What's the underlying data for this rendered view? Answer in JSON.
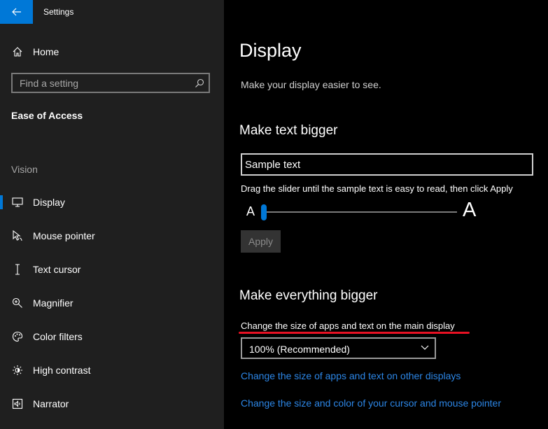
{
  "window": {
    "title": "Settings"
  },
  "sidebar": {
    "home_label": "Home",
    "search": {
      "placeholder": "Find a setting"
    },
    "section_title": "Ease of Access",
    "group_header": "Vision",
    "items": [
      {
        "label": "Display",
        "icon": "monitor-icon",
        "selected": true
      },
      {
        "label": "Mouse pointer",
        "icon": "mouse-pointer-icon"
      },
      {
        "label": "Text cursor",
        "icon": "text-cursor-icon"
      },
      {
        "label": "Magnifier",
        "icon": "magnifier-icon"
      },
      {
        "label": "Color filters",
        "icon": "palette-icon"
      },
      {
        "label": "High contrast",
        "icon": "high-contrast-icon"
      },
      {
        "label": "Narrator",
        "icon": "narrator-icon"
      }
    ]
  },
  "main": {
    "title": "Display",
    "subtitle": "Make your display easier to see.",
    "text_bigger": {
      "heading": "Make text bigger",
      "sample_text": "Sample text",
      "hint": "Drag the slider until the sample text is easy to read, then click Apply",
      "slider_min_label": "A",
      "slider_max_label": "A",
      "slider_value": 0,
      "apply_label": "Apply"
    },
    "everything_bigger": {
      "heading": "Make everything bigger",
      "change_label": "Change the size of apps and text on the main display",
      "dropdown_value": "100% (Recommended)",
      "link_other_displays": "Change the size of apps and text on other displays",
      "link_cursor": "Change the size and color of your cursor and mouse pointer"
    }
  },
  "colors": {
    "accent": "#0078d7",
    "link": "#2c86e6",
    "highlight_underline": "#e81123",
    "sidebar_bg": "#1f1f1f",
    "main_bg": "#000000"
  }
}
